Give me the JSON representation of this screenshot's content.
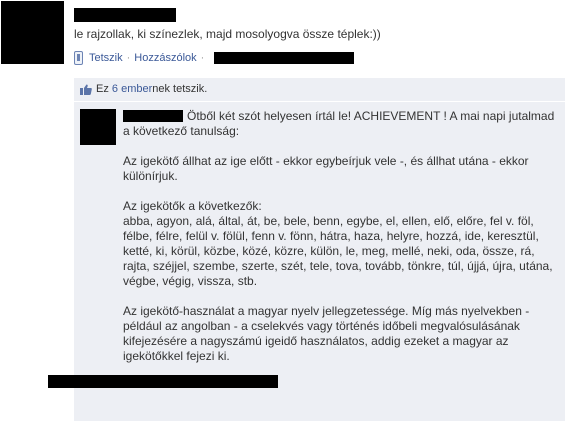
{
  "post": {
    "text": "le rajzollak, ki színezlek, majd mosolyogva össze téplek:))",
    "actions": {
      "like": "Tetszik",
      "comment": "Hozzászólok"
    },
    "separator": "·"
  },
  "likes": {
    "prefix": "Ez",
    "count_link": "6 ember",
    "suffix": "nek tetszik."
  },
  "comment": {
    "paragraphs": [
      "Ötből két szót helyesen írtál le! ACHIEVEMENT ! A mai napi jutalmad a következő tanulság:",
      "Az igekötő állhat az ige előtt - ekkor egybeírjuk vele -, és állhat utána - ekkor különírjuk.",
      "Az igekötők a következők:\nabba, agyon, alá, által, át, be, bele, benn, egybe, el, ellen, elő, előre, fel v. föl, félbe, félre, felül v. fölül, fenn v. fönn, hátra, haza, helyre, hozzá, ide, keresztül, ketté, ki, körül, közbe, közé, közre, külön, le, meg, mellé, neki, oda, össze, rá, rajta, széjjel, szembe, szerte, szét, tele, tova, tovább, tönkre, túl, újjá, újra, utána, végbe, végig, vissza, stb.",
      "Az igekötő-használat a magyar nyelv jellegzetessége. Míg más nyelvekben - például az angolban - a cselekvés vagy történés időbeli megvalósulásának kifejezésére a nagyszámú igeidő használatos, addig ezeket a magyar az igekötőkkel fejezi ki."
    ]
  },
  "colors": {
    "link": "#3b5998",
    "comments_bg": "#edeff4",
    "redaction": "#000000"
  },
  "icons": {
    "mobile": "mobile-phone-icon",
    "like": "thumbs-up-icon"
  }
}
